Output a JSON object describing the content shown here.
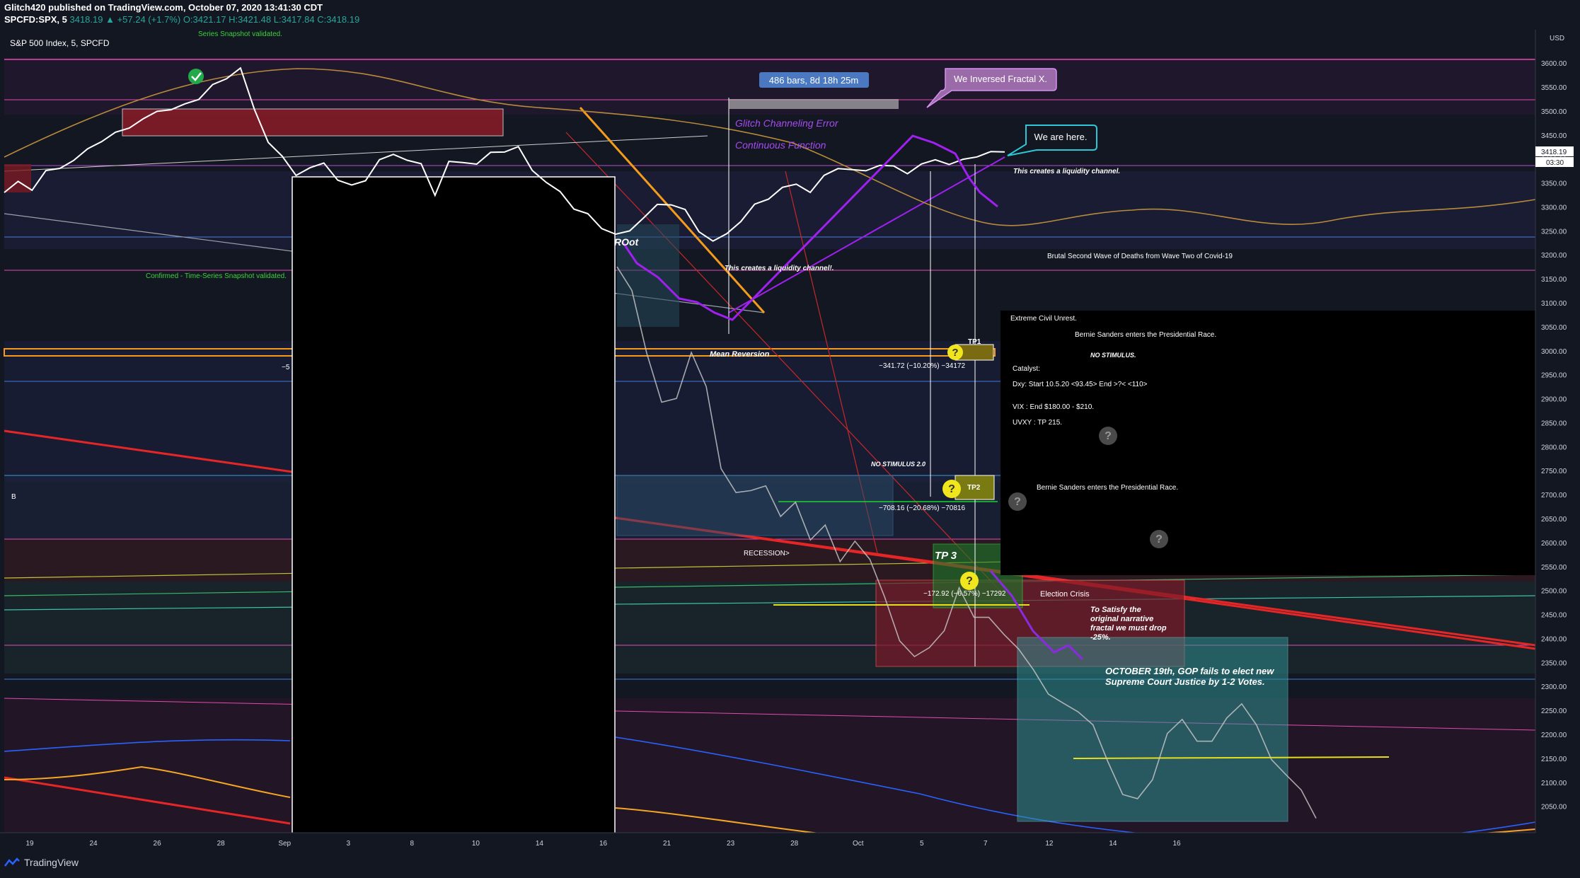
{
  "header": {
    "publisher_line": "Glitch420 published on TradingView.com, October 07, 2020 13:41:30 CDT",
    "symbol": "SPCFD:SPX, 5",
    "change": "3418.19 ▲ +57.24 (+1.7%)",
    "ohlc": "O:3421.17 H:3421.48 L:3417.84 C:3418.19"
  },
  "chart_data": {
    "type": "line",
    "title": "S&P 500 Index, 5, SPCFD",
    "currency": "USD",
    "y_ticks": [
      3600,
      3550,
      3500,
      3450,
      3400,
      3350,
      3300,
      3250,
      3200,
      3150,
      3100,
      3050,
      3000,
      2950,
      2900,
      2850,
      2800,
      2750,
      2700,
      2650,
      2600,
      2550,
      2500,
      2450,
      2400,
      2350,
      2300,
      2250,
      2200,
      2150,
      2100,
      2050
    ],
    "y_tick_labels": [
      "3600.00",
      "3550.00",
      "3500.00",
      "3450.00",
      "3400.00",
      "3350.00",
      "3300.00",
      "3250.00",
      "3200.00",
      "3150.00",
      "3100.00",
      "3050.00",
      "3000.00",
      "2950.00",
      "2900.00",
      "2850.00",
      "2800.00",
      "2750.00",
      "2700.00",
      "2650.00",
      "2600.00",
      "2550.00",
      "2500.00",
      "2450.00",
      "2400.00",
      "2350.00",
      "2300.00",
      "2250.00",
      "2200.00",
      "2150.00",
      "2100.00",
      "2050.00"
    ],
    "ylim": [
      2020,
      3640
    ],
    "x_tick_labels": [
      "19",
      "24",
      "26",
      "28",
      "Sep",
      "3",
      "8",
      "10",
      "14",
      "16",
      "21",
      "23",
      "28",
      "Oct",
      "5",
      "7",
      "12",
      "14",
      "16"
    ],
    "last_price": "3418.19",
    "countdown": "03:30",
    "series": [
      {
        "name": "",
        "color": "#ffffff",
        "values": [
          3330,
          3350,
          3340,
          3370,
          3385,
          3395,
          3420,
          3440,
          3450,
          3470,
          3480,
          3500,
          3505,
          3510,
          3530,
          3550,
          3570,
          3590,
          3500,
          3440,
          3400,
          3370,
          3380,
          3390,
          3360,
          3340,
          3360,
          3395,
          3410,
          3400,
          3385,
          3330,
          3390,
          3395,
          3390,
          3410,
          3420,
          3420,
          3380,
          3350,
          3330,
          3300,
          3280,
          3260,
          3240,
          3250,
          3280,
          3300,
          3310,
          3290,
          3250,
          3230,
          3240,
          3275,
          3300,
          3320,
          3340,
          3345,
          3335,
          3360,
          3385,
          3375,
          3375,
          3390,
          3380,
          3375,
          3385,
          3400,
          3390,
          3395,
          3410,
          3410,
          3418
        ]
      },
      {
        "name": "",
        "color": "#cccccc",
        "values": [
          3180,
          3120,
          3000,
          2890,
          2900,
          3000,
          2920,
          2760,
          2700,
          2710,
          2720,
          2650,
          2690,
          2600,
          2640,
          2560,
          2600,
          2570,
          2480,
          2400,
          2360,
          2380,
          2420,
          2500,
          2450,
          2440,
          2410,
          2380,
          2330,
          2290,
          2260,
          2250,
          2220,
          2140,
          2080,
          2060,
          2110,
          2200,
          2230,
          2190,
          2180,
          2240,
          2260,
          2220,
          2150,
          2110,
          2090,
          2020
        ]
      }
    ],
    "annotations": {
      "ruler": "486 bars, 8d 18h 25m",
      "fractal": "We Inversed Fractal X.",
      "we_are_here": "We are here.",
      "glitch": "Glitch Channeling Error",
      "continuous": "Continuous Function",
      "series_validated": "Series Snapshot validated.",
      "confirmed": "Confirmed - Time-Series Snapshot validated.",
      "liquidity1": "This creates a liquidity channel.",
      "liquidity2": "This creates a liquidity channel!.",
      "root": "ROot",
      "mean_reversion": "Mean Reversion",
      "tp1": "TP1",
      "tp1_measure": "−341.72 (−10.20%) −34172",
      "tp2": "TP2",
      "tp2_measure": "−708.16 (−20.68%) −70816",
      "tp3": "TP 3",
      "tp3_measure": "−172.92 (−6.57%) −17292",
      "no_stimulus_2": "NO STIMULUS 2.0",
      "recession": "RECESSION>",
      "election_crisis": "Election Crisis",
      "satisfy": "To Satisfy the original narrative fractal we must drop -25%.",
      "october": "OCTOBER 19th, GOP fails to elect new Supreme Court Justice by 1-2 Votes.",
      "brutal": "Brutal Second Wave of Deaths from Wave Two of Covid-19",
      "civil_unrest": "Extreme Civil Unrest.",
      "bernie1": "Bernie Sanders enters the Presidential Race.",
      "no_stimulus": "NO STIMULUS.",
      "catalyst": "Catalyst:",
      "dxy": "Dxy: Start 10.5.20 <93.45> End >?< <110>",
      "vix": "VIX : End $180.00 - $210.",
      "uvxy": "UVXY : TP 215.",
      "bernie2": "Bernie Sanders enters the Presidential Race.",
      "b_label": "B",
      "left_measure": "−5"
    }
  },
  "footer": {
    "brand": "TradingView"
  }
}
